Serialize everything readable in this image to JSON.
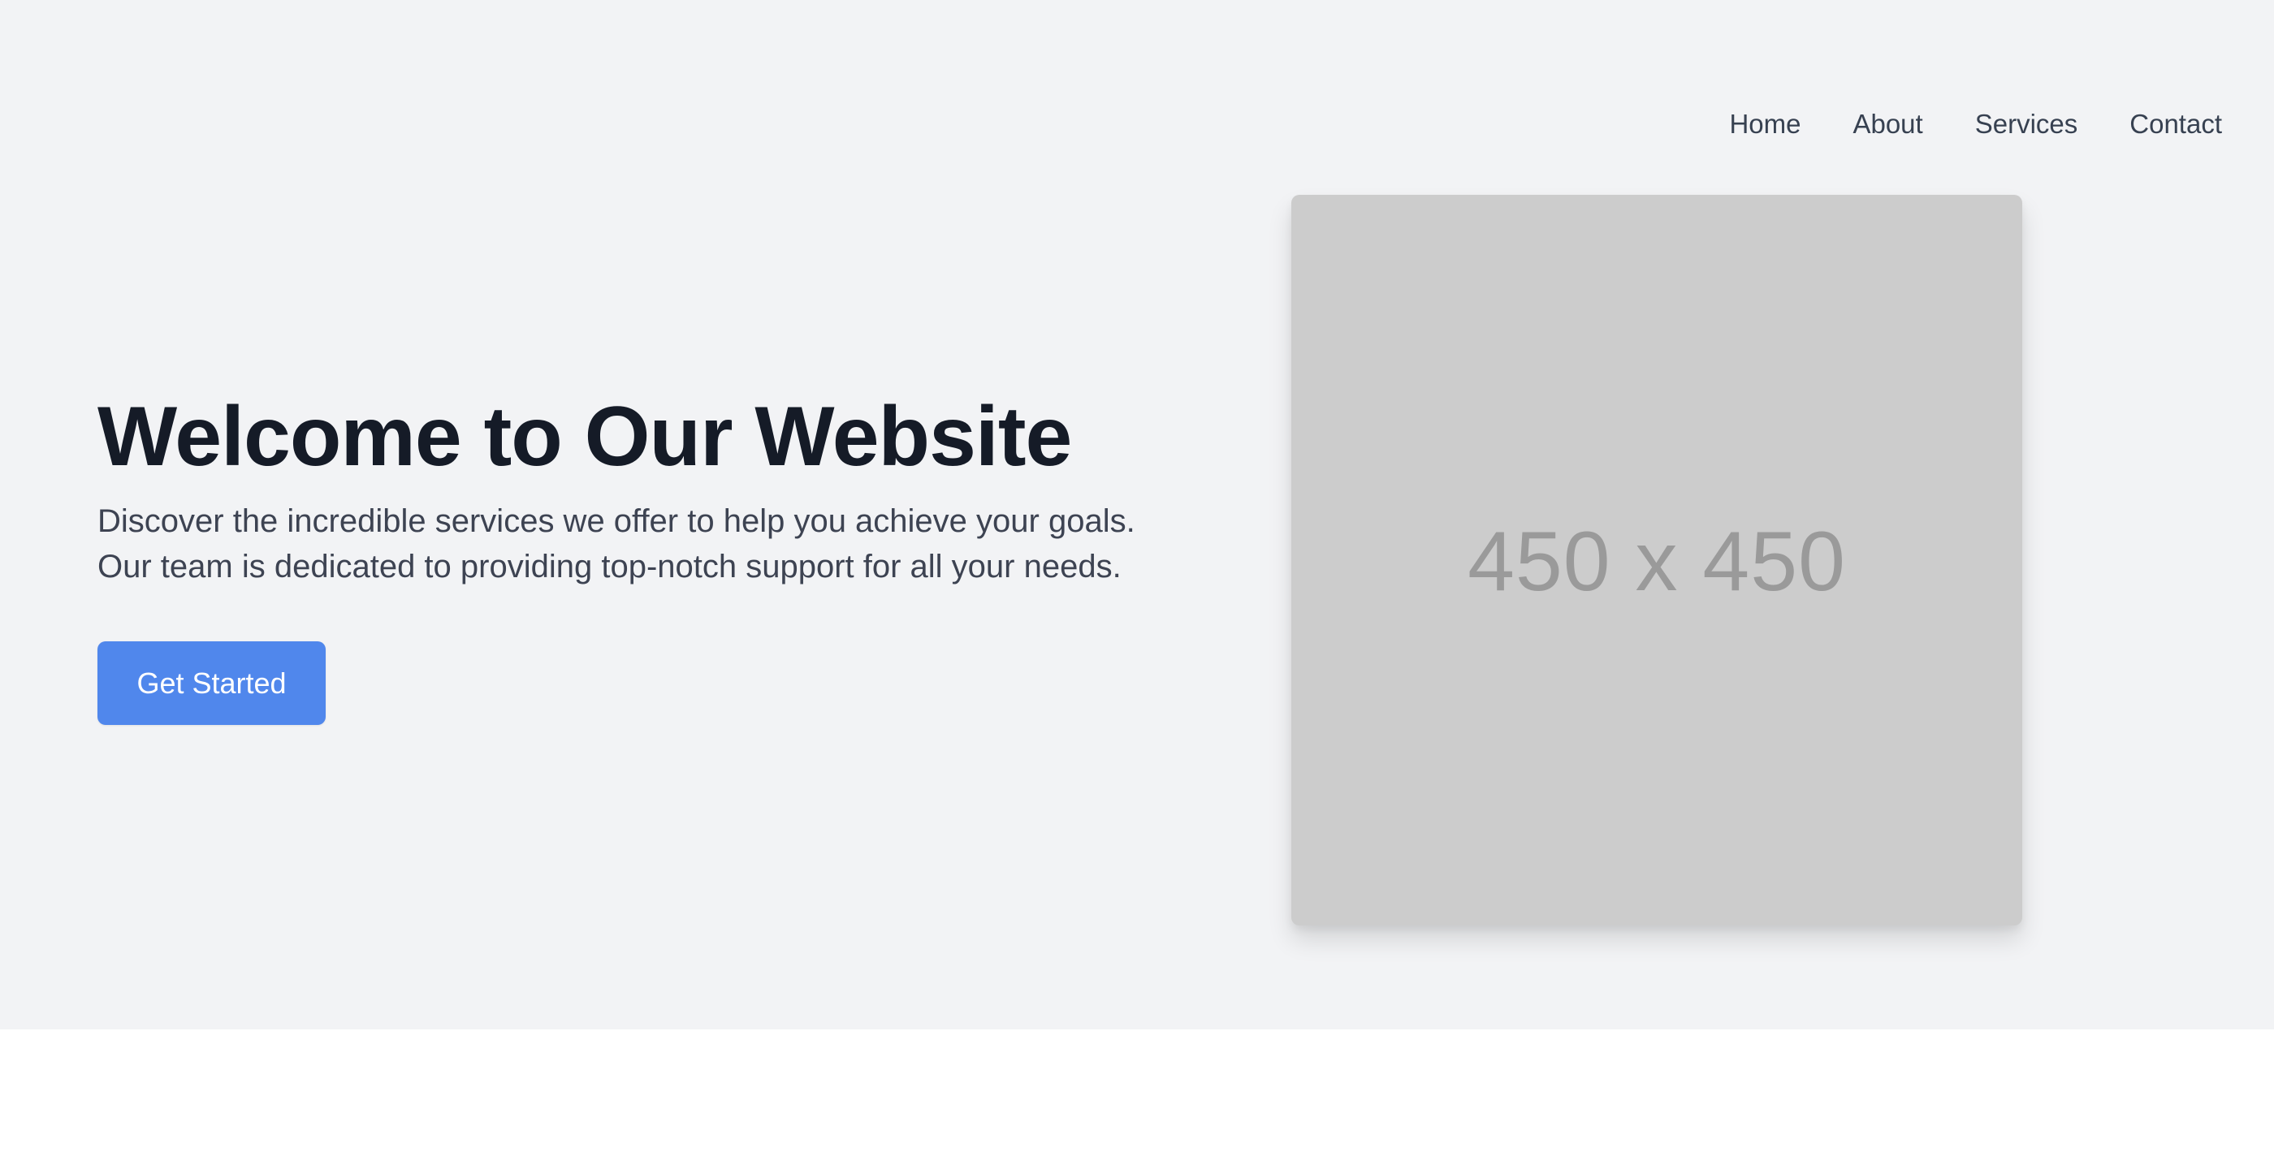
{
  "nav": {
    "items": [
      {
        "label": "Home"
      },
      {
        "label": "About"
      },
      {
        "label": "Services"
      },
      {
        "label": "Contact"
      }
    ]
  },
  "hero": {
    "title": "Welcome to Our Website",
    "description_lines": [
      "Discover the incredible services we offer to help you achieve your goals.",
      "Our team is dedicated to providing top-notch support for all your needs."
    ],
    "cta_label": "Get Started",
    "image_placeholder": "450 x 450"
  },
  "colors": {
    "hero_background": "#f2f3f5",
    "page_background": "#ffffff",
    "title": "#151b27",
    "body_text": "#3d4352",
    "accent": "#5087ec",
    "placeholder_background": "#cccccc",
    "placeholder_text": "#9a9a9a"
  }
}
